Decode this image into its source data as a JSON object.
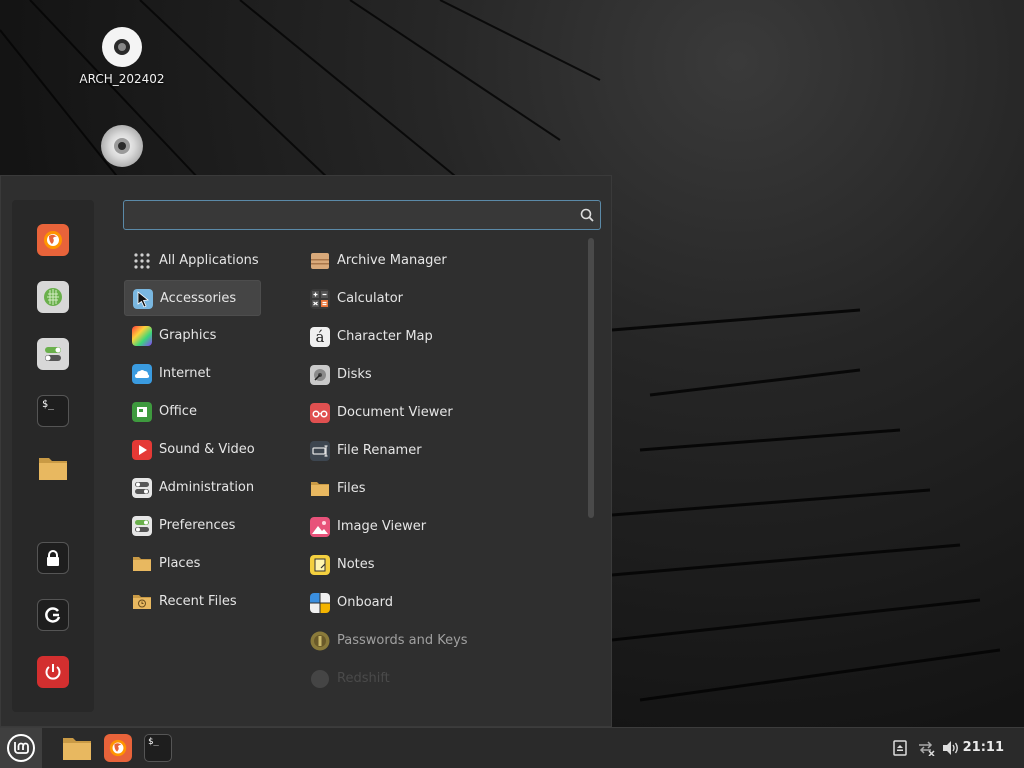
{
  "desktop": {
    "icons": [
      {
        "label": "ARCH_202402",
        "icon": "disc-icon"
      },
      {
        "label": "",
        "icon": "cdrom-icon"
      }
    ]
  },
  "menu": {
    "search": {
      "value": "",
      "placeholder": ""
    },
    "favorites": [
      {
        "name": "firefox",
        "icon": "firefox-icon",
        "color": "#e8633a"
      },
      {
        "name": "software-manager",
        "icon": "software-manager-icon",
        "color": "#6ab04c"
      },
      {
        "name": "system-settings",
        "icon": "settings-icon",
        "color": "#d8d8d8"
      },
      {
        "name": "terminal",
        "icon": "terminal-icon",
        "color": "#1e1e1e"
      },
      {
        "name": "files",
        "icon": "folder-icon",
        "color": "#e8b860"
      },
      {
        "name": "lock-screen",
        "icon": "lock-icon",
        "color": "#1e1e1e"
      },
      {
        "name": "logout",
        "icon": "logout-icon",
        "color": "#1e1e1e"
      },
      {
        "name": "shutdown",
        "icon": "power-icon",
        "color": "#d32f2f"
      }
    ],
    "categories": [
      {
        "label": "All Applications",
        "icon": "grid-icon"
      },
      {
        "label": "Accessories",
        "icon": "accessories-icon"
      },
      {
        "label": "Graphics",
        "icon": "graphics-icon"
      },
      {
        "label": "Internet",
        "icon": "internet-icon"
      },
      {
        "label": "Office",
        "icon": "office-icon"
      },
      {
        "label": "Sound & Video",
        "icon": "sound-video-icon"
      },
      {
        "label": "Administration",
        "icon": "administration-icon"
      },
      {
        "label": "Preferences",
        "icon": "preferences-icon"
      },
      {
        "label": "Places",
        "icon": "folder-icon"
      },
      {
        "label": "Recent Files",
        "icon": "recent-files-icon"
      }
    ],
    "selected_category": "Accessories",
    "apps": [
      {
        "label": "Archive Manager",
        "icon": "archive-icon"
      },
      {
        "label": "Calculator",
        "icon": "calculator-icon"
      },
      {
        "label": "Character Map",
        "icon": "character-map-icon"
      },
      {
        "label": "Disks",
        "icon": "disks-icon"
      },
      {
        "label": "Document Viewer",
        "icon": "document-viewer-icon"
      },
      {
        "label": "File Renamer",
        "icon": "file-renamer-icon"
      },
      {
        "label": "Files",
        "icon": "folder-icon"
      },
      {
        "label": "Image Viewer",
        "icon": "image-viewer-icon"
      },
      {
        "label": "Notes",
        "icon": "notes-icon"
      },
      {
        "label": "Onboard",
        "icon": "onboard-icon"
      },
      {
        "label": "Passwords and Keys",
        "icon": "passwords-icon"
      },
      {
        "label": "Redshift",
        "icon": "redshift-icon"
      }
    ]
  },
  "taskbar": {
    "launchers": [
      {
        "name": "files",
        "icon": "folder-icon"
      },
      {
        "name": "firefox",
        "icon": "firefox-icon"
      },
      {
        "name": "terminal",
        "icon": "terminal-icon"
      }
    ],
    "tray": [
      "removable-drive-icon",
      "network-disconnected-icon",
      "volume-icon"
    ],
    "clock": "21:11"
  },
  "colors": {
    "accent": "#5b8aa8",
    "menu_bg": "#2f2f2f",
    "text": "#e6e6e6"
  }
}
